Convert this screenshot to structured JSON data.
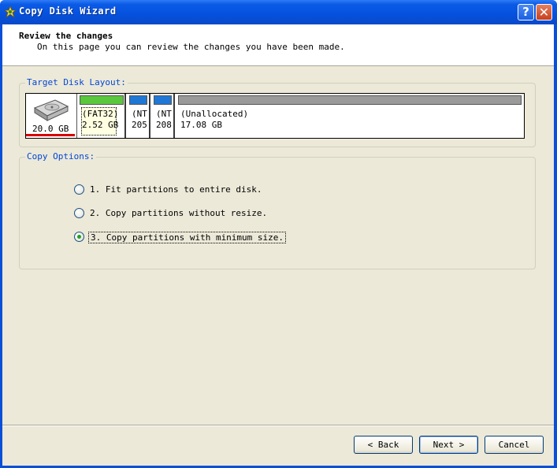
{
  "window": {
    "title": "Copy Disk Wizard",
    "help_label": "?",
    "close_label": "✕"
  },
  "header": {
    "title": "Review the changes",
    "subtitle": "On this page you can review the changes you have been made."
  },
  "target_disk": {
    "legend": "Target Disk Layout:",
    "disk_size": "20.0 GB",
    "partitions": [
      {
        "line1": "(FAT32)",
        "line2": "2.52 GB",
        "color": "#5ac83c"
      },
      {
        "line1": "(NT",
        "line2": "205",
        "color": "#1f78d6"
      },
      {
        "line1": "(NT",
        "line2": "208",
        "color": "#1f78d6"
      },
      {
        "line1": "(Unallocated)",
        "line2": "17.08 GB",
        "color": "#9a9a9a"
      }
    ]
  },
  "copy_options": {
    "legend": "Copy Options:",
    "options": [
      {
        "label": "1. Fit partitions to entire disk.",
        "selected": false
      },
      {
        "label": "2. Copy partitions without resize.",
        "selected": false
      },
      {
        "label": "3. Copy partitions with minimum size.",
        "selected": true
      }
    ]
  },
  "buttons": {
    "back": "< Back",
    "next": "Next >",
    "cancel": "Cancel"
  }
}
